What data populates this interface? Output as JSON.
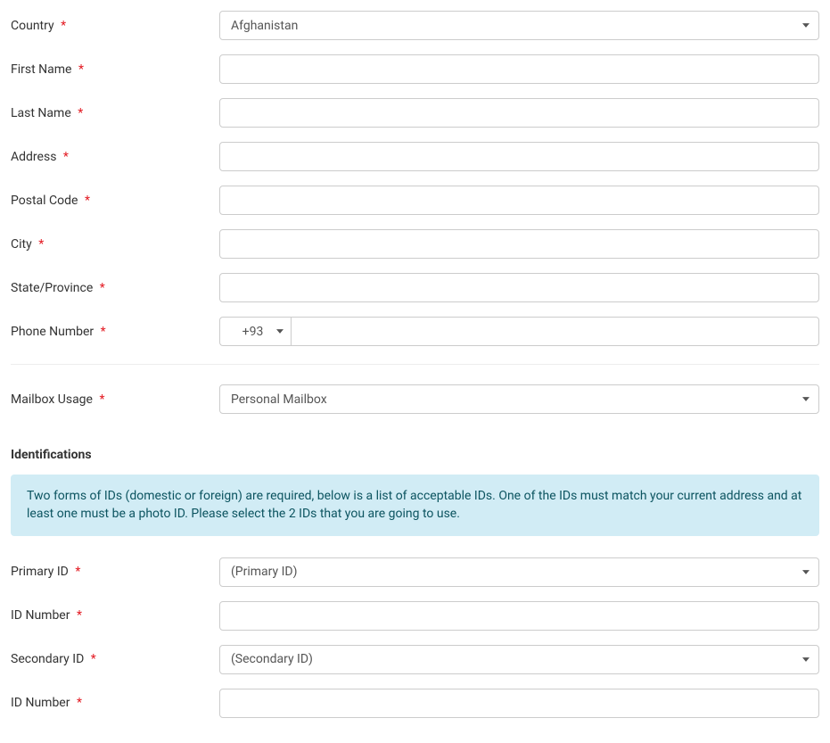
{
  "fields": {
    "country": {
      "label": "Country",
      "value": "Afghanistan"
    },
    "firstName": {
      "label": "First Name",
      "value": ""
    },
    "lastName": {
      "label": "Last Name",
      "value": ""
    },
    "address": {
      "label": "Address",
      "value": ""
    },
    "postalCode": {
      "label": "Postal Code",
      "value": ""
    },
    "city": {
      "label": "City",
      "value": ""
    },
    "stateProvince": {
      "label": "State/Province",
      "value": ""
    },
    "phoneNumber": {
      "label": "Phone Number",
      "code": "+93",
      "value": ""
    },
    "mailboxUsage": {
      "label": "Mailbox Usage",
      "value": "Personal Mailbox"
    }
  },
  "identifications": {
    "sectionTitle": "Identifications",
    "infoText": "Two forms of IDs (domestic or foreign) are required, below is a list of acceptable IDs. One of the IDs must match your current address and at least one must be a photo ID. Please select the 2 IDs that you are going to use.",
    "primaryId": {
      "label": "Primary ID",
      "value": "(Primary ID)"
    },
    "primaryIdNumber": {
      "label": "ID Number",
      "value": ""
    },
    "secondaryId": {
      "label": "Secondary ID",
      "value": "(Secondary ID)"
    },
    "secondaryIdNumber": {
      "label": "ID Number",
      "value": ""
    }
  },
  "requiredMark": "*"
}
